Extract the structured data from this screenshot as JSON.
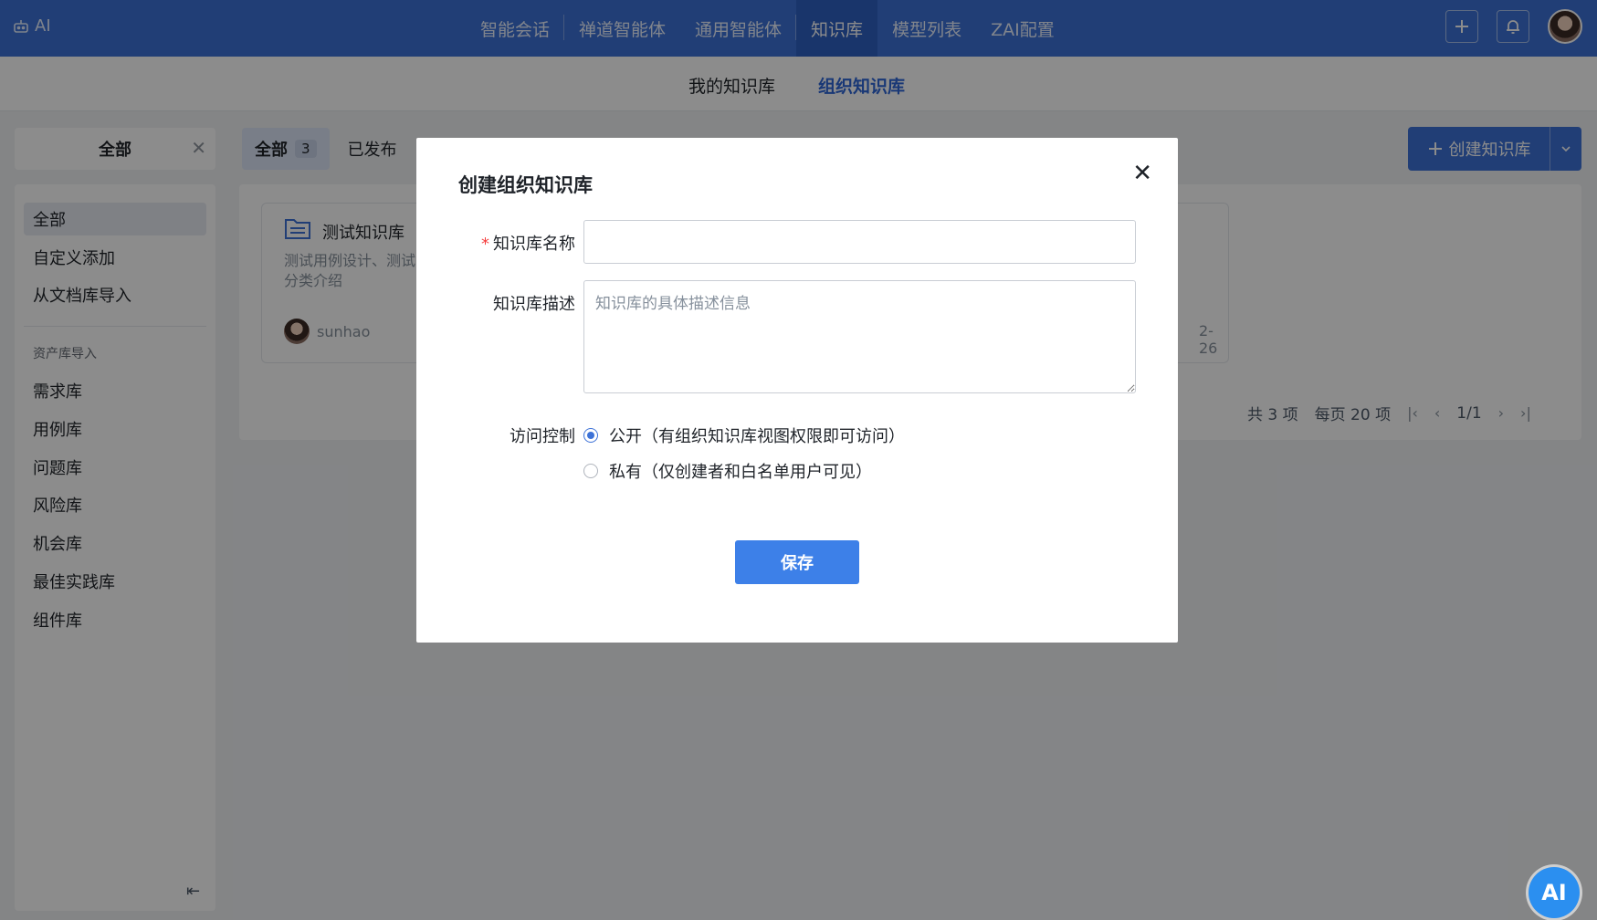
{
  "brand": {
    "label": "AI"
  },
  "nav": {
    "items": [
      {
        "label": "智能会话"
      },
      {
        "label": "禅道智能体"
      },
      {
        "label": "通用智能体"
      },
      {
        "label": "知识库"
      },
      {
        "label": "模型列表"
      },
      {
        "label": "ZAI配置"
      }
    ],
    "active": "知识库"
  },
  "subtabs": {
    "mine": "我的知识库",
    "org": "组织知识库",
    "active": "组织知识库"
  },
  "filter": {
    "label": "全部"
  },
  "status_tabs": {
    "all": {
      "label": "全部",
      "count": "3"
    },
    "published": {
      "label": "已发布"
    }
  },
  "create_button": {
    "label": "创建知识库"
  },
  "sidebar": {
    "items": [
      {
        "label": "全部"
      },
      {
        "label": "自定义添加"
      },
      {
        "label": "从文档库导入"
      }
    ],
    "group_title": "资产库导入",
    "group_items": [
      {
        "label": "需求库"
      },
      {
        "label": "用例库"
      },
      {
        "label": "问题库"
      },
      {
        "label": "风险库"
      },
      {
        "label": "机会库"
      },
      {
        "label": "最佳实践库"
      },
      {
        "label": "组件库"
      }
    ]
  },
  "card": {
    "title": "测试知识库",
    "desc": "测试用例设计、测试分类介绍",
    "user": "sunhao",
    "date": "2-26"
  },
  "pager": {
    "total": "共 3 项",
    "per_page": "每页 20 项",
    "page": "1/1"
  },
  "modal": {
    "title": "创建组织知识库",
    "name_label": "知识库名称",
    "name_value": "",
    "desc_label": "知识库描述",
    "desc_placeholder": "知识库的具体描述信息",
    "access_label": "访问控制",
    "public_option": "公开（有组织知识库视图权限即可访问）",
    "private_option": "私有（仅创建者和白名单用户可见）",
    "selected": "public",
    "save_label": "保存"
  },
  "ai_bubble": {
    "label": "AI"
  },
  "colors": {
    "primary": "#3d72d7",
    "required": "#f53f3f"
  }
}
